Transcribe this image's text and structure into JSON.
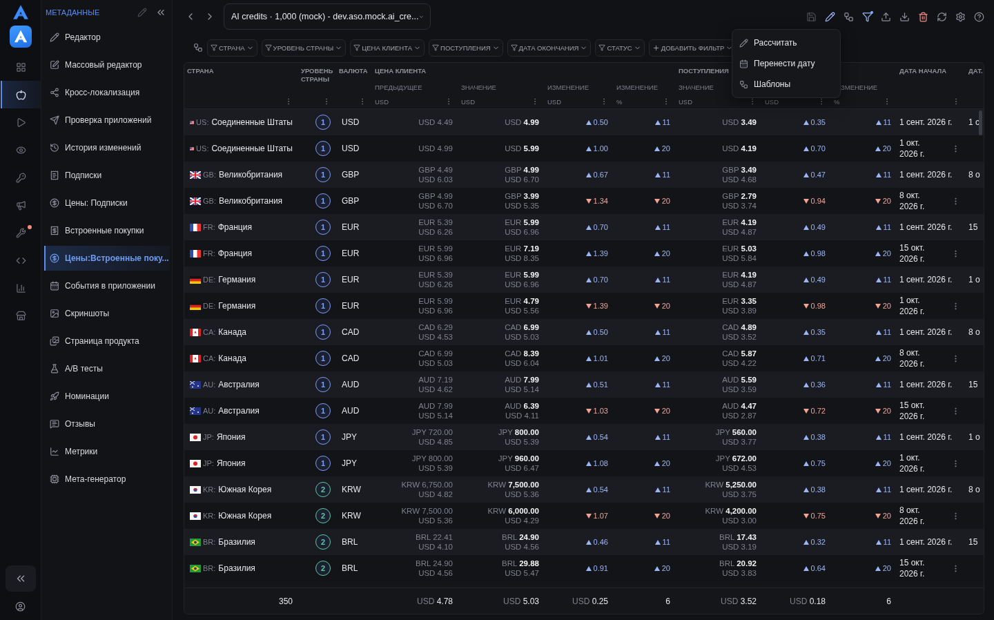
{
  "rail": {
    "items": [
      {
        "selected": false,
        "badge": false
      },
      {
        "selected": true,
        "badge": false
      },
      {
        "selected": false,
        "badge": false
      },
      {
        "selected": false,
        "badge": false
      },
      {
        "selected": false,
        "badge": false
      },
      {
        "selected": false,
        "badge": false
      },
      {
        "selected": false,
        "badge": true
      },
      {
        "selected": false,
        "badge": false
      },
      {
        "selected": false,
        "badge": false
      },
      {
        "selected": false,
        "badge": false
      }
    ]
  },
  "nav": {
    "title": "МЕТАДАННЫЕ",
    "items": [
      {
        "label": "Редактор",
        "selected": false
      },
      {
        "label": "Массовый редактор",
        "selected": false
      },
      {
        "label": "Кросс-локализация",
        "selected": false
      },
      {
        "label": "Проверка приложений",
        "selected": false
      },
      {
        "label": "История изменений",
        "selected": false
      },
      {
        "label": "Подписки",
        "selected": false
      },
      {
        "label": "Цены: Подписки",
        "selected": false
      },
      {
        "label": "Встроенные покупки",
        "selected": false
      },
      {
        "label": "Цены:Встроенные поку...",
        "selected": true
      },
      {
        "label": "События в приложении",
        "selected": false
      },
      {
        "label": "Скриншоты",
        "selected": false
      },
      {
        "label": "Страница продукта",
        "selected": false
      },
      {
        "label": "A/B тесты",
        "selected": false
      },
      {
        "label": "Номинации",
        "selected": false
      },
      {
        "label": "Отзывы",
        "selected": false
      },
      {
        "label": "Метрики",
        "selected": false
      },
      {
        "label": "Мета-генератор",
        "selected": false
      }
    ]
  },
  "app_selector": "AI credits · 1,000 (mock) - dev.aso.mock.ai_cre...",
  "filters": [
    {
      "label": "СТРАНА"
    },
    {
      "label": "УРОВЕНЬ СТРАНЫ"
    },
    {
      "label": "ЦЕНА КЛИЕНТА"
    },
    {
      "label": "ПОСТУПЛЕНИЯ"
    },
    {
      "label": "ДАТА ОКОНЧАНИЯ"
    },
    {
      "label": "СТАТУС"
    }
  ],
  "add_filter": "ДОБАВИТЬ ФИЛЬТР",
  "menu": {
    "items": [
      {
        "label": "Рассчитать"
      },
      {
        "label": "Перенести дату"
      },
      {
        "label": "Шаблоны"
      }
    ]
  },
  "table": {
    "columns": [
      {
        "label": "СТРАНА",
        "menu": true
      },
      {
        "label": "УРОВЕНЬ СТРАНЫ",
        "menu": true
      },
      {
        "label": "ВАЛЮТА",
        "menu": true
      },
      {
        "label": "ЦЕНА КЛИЕНТА",
        "children": [
          {
            "label": "ПРЕДЫДУЩЕЕ",
            "unit": "USD"
          },
          {
            "label": "ЗНАЧЕНИЕ",
            "unit": "USD"
          },
          {
            "label": "ИЗМЕНЕНИЕ",
            "unit": "USD"
          },
          {
            "label": "ИЗМЕНЕНИЕ",
            "unit": "%"
          }
        ]
      },
      {
        "label": "ПОСТУПЛЕНИЯ",
        "children": [
          {
            "label": "ЗНАЧЕНИЕ",
            "unit": "USD"
          },
          {
            "unit": "USD"
          },
          {
            "label": "ЗМЕНЕНИЕ",
            "unit": "%"
          }
        ]
      },
      {
        "label": "ДАТА НАЧАЛА",
        "menu": true
      },
      {
        "label": "ДАТ.",
        "menu": false
      }
    ],
    "rows": [
      {
        "kind": "us",
        "code": "US:",
        "country": "Соединенные Штаты",
        "tier": {
          "text": "1",
          "color": "#7f9cf5"
        },
        "currency": "USD",
        "prev": [
          "USD 4.49"
        ],
        "value": [
          "USD **4.99**"
        ],
        "change": {
          "rising": true,
          "text": "0.50"
        },
        "change_pct": {
          "rising": true,
          "text": "11"
        },
        "proceeds": [
          "USD **3.49**"
        ],
        "proceeds_change": {
          "rising": true,
          "text": "0.35"
        },
        "proceeds_change_pct": {
          "rising": true,
          "text": "11"
        },
        "start": "1 сент. 2026 г.",
        "end": "1 с"
      },
      {
        "kind": "us",
        "code": "US:",
        "country": "Соединенные Штаты",
        "tier": {
          "text": "1",
          "color": "#7f9cf5"
        },
        "currency": "USD",
        "prev": [
          "USD 4.99"
        ],
        "value": [
          "USD **5.99**"
        ],
        "change": {
          "rising": true,
          "text": "1.00"
        },
        "change_pct": {
          "rising": true,
          "text": "20"
        },
        "proceeds": [
          "USD **4.19**"
        ],
        "proceeds_change": {
          "rising": true,
          "text": "0.70"
        },
        "proceeds_change_pct": {
          "rising": true,
          "text": "20"
        },
        "start": "1 окт. 2026 г."
      },
      {
        "kind": "gb",
        "code": "GB:",
        "country": "Великобритания",
        "tier": {
          "text": "1",
          "color": "#7f9cf5"
        },
        "currency": "GBP",
        "prev": [
          "GBP 4.49",
          "USD 6.03"
        ],
        "value": [
          "GBP **4.99**",
          "USD 6.70"
        ],
        "change": {
          "rising": true,
          "text": "0.67"
        },
        "change_pct": {
          "rising": true,
          "text": "11"
        },
        "proceeds": [
          "GBP **3.49**",
          "USD 4.68"
        ],
        "proceeds_change": {
          "rising": true,
          "text": "0.47"
        },
        "proceeds_change_pct": {
          "rising": true,
          "text": "11"
        },
        "start": "1 сент. 2026 г.",
        "end": "8 о"
      },
      {
        "kind": "gb",
        "code": "GB:",
        "country": "Великобритания",
        "tier": {
          "text": "1",
          "color": "#7f9cf5"
        },
        "currency": "GBP",
        "prev": [
          "GBP 4.99",
          "USD 6.70"
        ],
        "value": [
          "GBP **3.99**",
          "USD 5.35"
        ],
        "change": {
          "rising": false,
          "text": "1.34"
        },
        "change_pct": {
          "rising": false,
          "text": "20"
        },
        "proceeds": [
          "GBP **2.79**",
          "USD 3.74"
        ],
        "proceeds_change": {
          "rising": false,
          "text": "0.94"
        },
        "proceeds_change_pct": {
          "rising": false,
          "text": "20"
        },
        "start": "8 окт. 2026 г."
      },
      {
        "kind": "fr",
        "code": "FR:",
        "country": "Франция",
        "tier": {
          "text": "1",
          "color": "#7f9cf5"
        },
        "currency": "EUR",
        "prev": [
          "EUR 5.39",
          "USD 6.26"
        ],
        "value": [
          "EUR **5.99**",
          "USD 6.96"
        ],
        "change": {
          "rising": true,
          "text": "0.70"
        },
        "change_pct": {
          "rising": true,
          "text": "11"
        },
        "proceeds": [
          "EUR **4.19**",
          "USD 4.87"
        ],
        "proceeds_change": {
          "rising": true,
          "text": "0.49"
        },
        "proceeds_change_pct": {
          "rising": true,
          "text": "11"
        },
        "start": "1 сент. 2026 г.",
        "end": "15"
      },
      {
        "kind": "fr",
        "code": "FR:",
        "country": "Франция",
        "tier": {
          "text": "1",
          "color": "#7f9cf5"
        },
        "currency": "EUR",
        "prev": [
          "EUR 5.99",
          "USD 6.96"
        ],
        "value": [
          "EUR **7.19**",
          "USD 8.35"
        ],
        "change": {
          "rising": true,
          "text": "1.39"
        },
        "change_pct": {
          "rising": true,
          "text": "20"
        },
        "proceeds": [
          "EUR **5.03**",
          "USD 5.84"
        ],
        "proceeds_change": {
          "rising": true,
          "text": "0.98"
        },
        "proceeds_change_pct": {
          "rising": true,
          "text": "20"
        },
        "start": "15 окт. 2026 г."
      },
      {
        "kind": "de",
        "code": "DE:",
        "country": "Германия",
        "tier": {
          "text": "1",
          "color": "#7f9cf5"
        },
        "currency": "EUR",
        "prev": [
          "EUR 5.39",
          "USD 6.26"
        ],
        "value": [
          "EUR **5.99**",
          "USD 6.96"
        ],
        "change": {
          "rising": true,
          "text": "0.70"
        },
        "change_pct": {
          "rising": true,
          "text": "11"
        },
        "proceeds": [
          "EUR **4.19**",
          "USD 4.87"
        ],
        "proceeds_change": {
          "rising": true,
          "text": "0.49"
        },
        "proceeds_change_pct": {
          "rising": true,
          "text": "11"
        },
        "start": "1 сент. 2026 г.",
        "end": "1 о"
      },
      {
        "kind": "de",
        "code": "DE:",
        "country": "Германия",
        "tier": {
          "text": "1",
          "color": "#7f9cf5"
        },
        "currency": "EUR",
        "prev": [
          "EUR 5.99",
          "USD 6.96"
        ],
        "value": [
          "EUR **4.79**",
          "USD 5.56"
        ],
        "change": {
          "rising": false,
          "text": "1.39"
        },
        "change_pct": {
          "rising": false,
          "text": "20"
        },
        "proceeds": [
          "EUR **3.35**",
          "USD 3.89"
        ],
        "proceeds_change": {
          "rising": false,
          "text": "0.98"
        },
        "proceeds_change_pct": {
          "rising": false,
          "text": "20"
        },
        "start": "1 окт. 2026 г."
      },
      {
        "kind": "ca",
        "code": "CA:",
        "country": "Канада",
        "tier": {
          "text": "1",
          "color": "#7f9cf5"
        },
        "currency": "CAD",
        "prev": [
          "CAD 6.29",
          "USD 4.53"
        ],
        "value": [
          "CAD **6.99**",
          "USD 5.03"
        ],
        "change": {
          "rising": true,
          "text": "0.50"
        },
        "change_pct": {
          "rising": true,
          "text": "11"
        },
        "proceeds": [
          "CAD **4.89**",
          "USD 3.52"
        ],
        "proceeds_change": {
          "rising": true,
          "text": "0.35"
        },
        "proceeds_change_pct": {
          "rising": true,
          "text": "11"
        },
        "start": "1 сент. 2026 г.",
        "end": "8 о"
      },
      {
        "kind": "ca",
        "code": "CA:",
        "country": "Канада",
        "tier": {
          "text": "1",
          "color": "#7f9cf5"
        },
        "currency": "CAD",
        "prev": [
          "CAD 6.99",
          "USD 5.03"
        ],
        "value": [
          "CAD **8.39**",
          "USD 6.04"
        ],
        "change": {
          "rising": true,
          "text": "1.01"
        },
        "change_pct": {
          "rising": true,
          "text": "20"
        },
        "proceeds": [
          "CAD **5.87**",
          "USD 4.22"
        ],
        "proceeds_change": {
          "rising": true,
          "text": "0.71"
        },
        "proceeds_change_pct": {
          "rising": true,
          "text": "20"
        },
        "start": "8 окт. 2026 г."
      },
      {
        "kind": "au",
        "code": "AU:",
        "country": "Австралия",
        "tier": {
          "text": "1",
          "color": "#7f9cf5"
        },
        "currency": "AUD",
        "prev": [
          "AUD 7.19",
          "USD 4.62"
        ],
        "value": [
          "AUD **7.99**",
          "USD 5.14"
        ],
        "change": {
          "rising": true,
          "text": "0.51"
        },
        "change_pct": {
          "rising": true,
          "text": "11"
        },
        "proceeds": [
          "AUD **5.59**",
          "USD 3.59"
        ],
        "proceeds_change": {
          "rising": true,
          "text": "0.36"
        },
        "proceeds_change_pct": {
          "rising": true,
          "text": "11"
        },
        "start": "1 сент. 2026 г.",
        "end": "15"
      },
      {
        "kind": "au",
        "code": "AU:",
        "country": "Австралия",
        "tier": {
          "text": "1",
          "color": "#7f9cf5"
        },
        "currency": "AUD",
        "prev": [
          "AUD 7.99",
          "USD 5.14"
        ],
        "value": [
          "AUD **6.39**",
          "USD 4.11"
        ],
        "change": {
          "rising": false,
          "text": "1.03"
        },
        "change_pct": {
          "rising": false,
          "text": "20"
        },
        "proceeds": [
          "AUD **4.47**",
          "USD 2.87"
        ],
        "proceeds_change": {
          "rising": false,
          "text": "0.72"
        },
        "proceeds_change_pct": {
          "rising": false,
          "text": "20"
        },
        "start": "15 окт. 2026 г."
      },
      {
        "kind": "jp",
        "code": "JP:",
        "country": "Япония",
        "tier": {
          "text": "1",
          "color": "#7f9cf5"
        },
        "currency": "JPY",
        "prev": [
          "JPY 720.00",
          "USD 4.85"
        ],
        "value": [
          "JPY **800.00**",
          "USD 5.39"
        ],
        "change": {
          "rising": true,
          "text": "0.54"
        },
        "change_pct": {
          "rising": true,
          "text": "11"
        },
        "proceeds": [
          "JPY **560.00**",
          "USD 3.77"
        ],
        "proceeds_change": {
          "rising": true,
          "text": "0.38"
        },
        "proceeds_change_pct": {
          "rising": true,
          "text": "11"
        },
        "start": "1 сент. 2026 г.",
        "end": "1 о"
      },
      {
        "kind": "jp",
        "code": "JP:",
        "country": "Япония",
        "tier": {
          "text": "1",
          "color": "#7f9cf5"
        },
        "currency": "JPY",
        "prev": [
          "JPY 800.00",
          "USD 5.39"
        ],
        "value": [
          "JPY **960.00**",
          "USD 6.47"
        ],
        "change": {
          "rising": true,
          "text": "1.08"
        },
        "change_pct": {
          "rising": true,
          "text": "20"
        },
        "proceeds": [
          "JPY **672.00**",
          "USD 4.53"
        ],
        "proceeds_change": {
          "rising": true,
          "text": "0.75"
        },
        "proceeds_change_pct": {
          "rising": true,
          "text": "20"
        },
        "start": "1 окт. 2026 г."
      },
      {
        "kind": "kr",
        "code": "KR:",
        "country": "Южная Корея",
        "tier": {
          "text": "2",
          "color": "#5fc8a0"
        },
        "currency": "KRW",
        "prev": [
          "KRW 6,750.00",
          "USD 4.82"
        ],
        "value": [
          "KRW **7,500.00**",
          "USD 5.36"
        ],
        "change": {
          "rising": true,
          "text": "0.54"
        },
        "change_pct": {
          "rising": true,
          "text": "11"
        },
        "proceeds": [
          "KRW **5,250.00**",
          "USD 3.75"
        ],
        "proceeds_change": {
          "rising": true,
          "text": "0.38"
        },
        "proceeds_change_pct": {
          "rising": true,
          "text": "11"
        },
        "start": "1 сент. 2026 г.",
        "end": "8 о"
      },
      {
        "kind": "kr",
        "code": "KR:",
        "country": "Южная Корея",
        "tier": {
          "text": "2",
          "color": "#5fc8a0"
        },
        "currency": "KRW",
        "prev": [
          "KRW 7,500.00",
          "USD 5.36"
        ],
        "value": [
          "KRW **6,000.00**",
          "USD 4.29"
        ],
        "change": {
          "rising": false,
          "text": "1.07"
        },
        "change_pct": {
          "rising": false,
          "text": "20"
        },
        "proceeds": [
          "KRW **4,200.00**",
          "USD 3.00"
        ],
        "proceeds_change": {
          "rising": false,
          "text": "0.75"
        },
        "proceeds_change_pct": {
          "rising": false,
          "text": "20"
        },
        "start": "8 окт. 2026 г."
      },
      {
        "kind": "br",
        "code": "BR:",
        "country": "Бразилия",
        "tier": {
          "text": "2",
          "color": "#5fc8a0"
        },
        "currency": "BRL",
        "prev": [
          "BRL 22.41",
          "USD 4.10"
        ],
        "value": [
          "BRL **24.90**",
          "USD 4.56"
        ],
        "change": {
          "rising": true,
          "text": "0.46"
        },
        "change_pct": {
          "rising": true,
          "text": "11"
        },
        "proceeds": [
          "BRL **17.43**",
          "USD 3.19"
        ],
        "proceeds_change": {
          "rising": true,
          "text": "0.32"
        },
        "proceeds_change_pct": {
          "rising": true,
          "text": "11"
        },
        "start": "1 сент. 2026 г.",
        "end": "15"
      },
      {
        "kind": "br",
        "code": "BR:",
        "country": "Бразилия",
        "tier": {
          "text": "2",
          "color": "#5fc8a0"
        },
        "currency": "BRL",
        "prev": [
          "BRL 24.90",
          "USD 4.56"
        ],
        "value": [
          "BRL **29.88**",
          "USD 5.47"
        ],
        "change": {
          "rising": true,
          "text": "0.91"
        },
        "change_pct": {
          "rising": true,
          "text": "20"
        },
        "proceeds": [
          "BRL **20.92**",
          "USD 3.83"
        ],
        "proceeds_change": {
          "rising": true,
          "text": "0.64"
        },
        "proceeds_change_pct": {
          "rising": true,
          "text": "20"
        },
        "start": "15 окт. 2026 г."
      }
    ],
    "footer": {
      "count": "350",
      "prev": "USD **4.78**",
      "value": "USD **5.03**",
      "change": "USD **0.25**",
      "change_pct": "6",
      "proceeds": "USD **3.52**",
      "proceeds_change": "USD **0.18**",
      "proceeds_change_pct": "6"
    }
  }
}
